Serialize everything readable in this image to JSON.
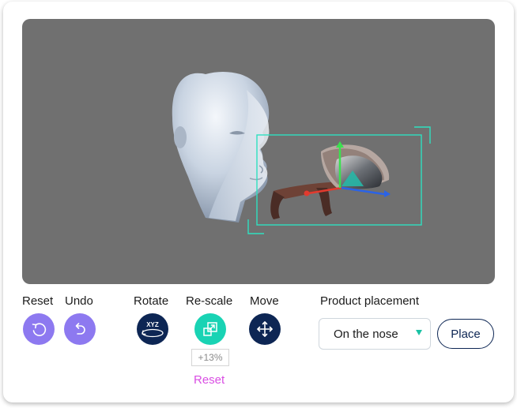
{
  "toolbar": {
    "reset_label": "Reset",
    "undo_label": "Undo",
    "rotate_label": "Rotate",
    "rescale_label": "Re-scale",
    "move_label": "Move",
    "rotate_icon_text": "XYZ",
    "scale_value": "+13%",
    "scale_reset_label": "Reset"
  },
  "placement": {
    "title": "Product placement",
    "selected": "On the nose",
    "place_label": "Place"
  },
  "icons": {
    "reset": "rotate-left-icon",
    "undo": "undo-icon",
    "rotate": "xyz-rotate-icon",
    "rescale": "rescale-icon",
    "move": "move-arrows-icon"
  },
  "colors": {
    "viewport_bg": "#707070",
    "primary_purple": "#8d79f0",
    "navy": "#0d2654",
    "teal": "#19d3b4",
    "reset_link": "#d94ee3",
    "selection_box": "#2fe0c0"
  }
}
